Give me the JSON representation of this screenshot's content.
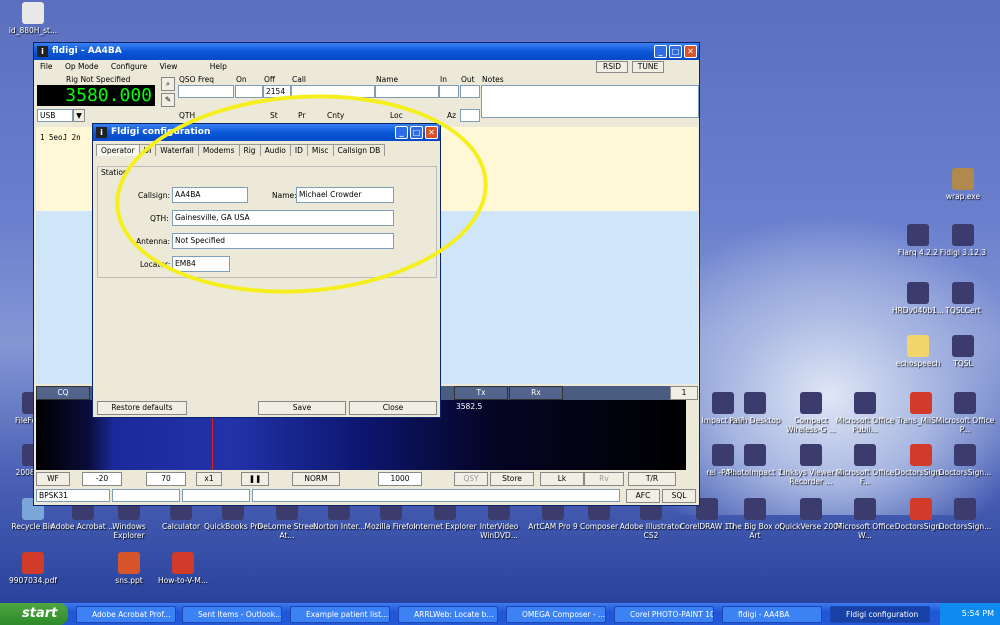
{
  "desktop_icons": [
    {
      "label": "id_880H_st...",
      "icon": "file-icon"
    },
    {
      "label": "wrap.exe",
      "icon": "box-icon"
    },
    {
      "label": "Flarq 4.2.2",
      "icon": "app-icon"
    },
    {
      "label": "Fldigi 3.12.3",
      "icon": "app-icon"
    },
    {
      "label": "HRDv040b1...",
      "icon": "app-icon"
    },
    {
      "label": "TQSLCert",
      "icon": "app-icon"
    },
    {
      "label": "echospeech",
      "icon": "folder-icon"
    },
    {
      "label": "TQSL",
      "icon": "app-icon"
    },
    {
      "label": "FileForma",
      "icon": "app-icon"
    },
    {
      "label": "2008Tour",
      "icon": "app-icon"
    },
    {
      "label": "Impact m 7",
      "icon": "app-icon"
    },
    {
      "label": "Palm Desktop",
      "icon": "app-icon"
    },
    {
      "label": "Compact Wireless-G ...",
      "icon": "app-icon"
    },
    {
      "label": "Microsoft Office Publi...",
      "icon": "app-icon"
    },
    {
      "label": "Trans_MilSi...",
      "icon": "pdf-icon"
    },
    {
      "label": "Microsoft Office P...",
      "icon": "app-icon"
    },
    {
      "label": "rel -PAI...",
      "icon": "app-icon"
    },
    {
      "label": "PhotoImpact 7",
      "icon": "app-icon"
    },
    {
      "label": "Linksys Viewer & Recorder ...",
      "icon": "app-icon"
    },
    {
      "label": "Microsoft Office F...",
      "icon": "app-icon"
    },
    {
      "label": "DoctorsSign...",
      "icon": "pdf-icon"
    },
    {
      "label": "DoctorsSign...",
      "icon": "app-icon"
    },
    {
      "label": "Recycle Bin",
      "icon": "recycle-icon"
    },
    {
      "label": "Adobe Acrobat ...",
      "icon": "app-icon"
    },
    {
      "label": "Windows Explorer",
      "icon": "app-icon"
    },
    {
      "label": "Calculator",
      "icon": "app-icon"
    },
    {
      "label": "QuickBooks Pro",
      "icon": "app-icon"
    },
    {
      "label": "DeLorme Street At...",
      "icon": "app-icon"
    },
    {
      "label": "Norton Inter...",
      "icon": "app-icon"
    },
    {
      "label": "Mozilla Firefox",
      "icon": "app-icon"
    },
    {
      "label": "Internet Explorer",
      "icon": "app-icon"
    },
    {
      "label": "InterVideo WinDVD...",
      "icon": "app-icon"
    },
    {
      "label": "ArtCAM Pro 9",
      "icon": "app-icon"
    },
    {
      "label": "Composer",
      "icon": "app-icon"
    },
    {
      "label": "Adobe Illustrator CS2",
      "icon": "app-icon"
    },
    {
      "label": "CorelDRAW 10",
      "icon": "app-icon"
    },
    {
      "label": "The Big Box of Art",
      "icon": "app-icon"
    },
    {
      "label": "QuickVerse 2007",
      "icon": "app-icon"
    },
    {
      "label": "Microsoft Office W...",
      "icon": "app-icon"
    },
    {
      "label": "DoctorsSign...",
      "icon": "pdf-icon"
    },
    {
      "label": "DoctorsSign...",
      "icon": "app-icon"
    },
    {
      "label": "9907034.pdf",
      "icon": "pdf-icon"
    },
    {
      "label": "sns.ppt",
      "icon": "ppt-icon"
    },
    {
      "label": "How-to-V-M...",
      "icon": "pdf-icon"
    }
  ],
  "main_window": {
    "title": "fldigi - AA4BA",
    "menu": [
      "File",
      "Op Mode",
      "Configure",
      "View",
      "Help"
    ],
    "rsid": "RSID",
    "tune": "TUNE",
    "rig_status": "Rig Not Specified",
    "frequency": "3580.000",
    "mode": "USB",
    "headers": {
      "qso_freq": "QSO Freq",
      "on": "On",
      "off": "Off",
      "call": "Call",
      "name": "Name",
      "in": "In",
      "out": "Out",
      "notes": "Notes"
    },
    "off_value": "2154",
    "row2": {
      "qth": "QTH",
      "st": "St",
      "pr": "Pr",
      "cnty": "Cnty",
      "loc": "Loc",
      "az": "Az"
    },
    "rx_text": "1  5eoJ  2n",
    "cq": "CQ",
    "tx": "Tx",
    "rx": "Rx",
    "count": "1",
    "waterfall_freq": "3582.5",
    "controls": {
      "wf": "WF",
      "level1": "-20",
      "level2": "70",
      "zoom": "x1",
      "norm": "NORM",
      "freq": "1000",
      "qsy": "QSY",
      "store": "Store",
      "lk": "Lk",
      "rv": "Rv",
      "tr": "T/R"
    },
    "status": {
      "mode": "BPSK31",
      "afc": "AFC",
      "sql": "SQL"
    }
  },
  "config_dialog": {
    "title": "Fldigi configuration",
    "tabs": [
      "Operator",
      "UI",
      "Waterfall",
      "Modems",
      "Rig",
      "Audio",
      "ID",
      "Misc",
      "Callsign DB"
    ],
    "group": "Station",
    "callsign_label": "Callsign:",
    "callsign": "AA4BA",
    "name_label": "Name:",
    "name": "Michael Crowder",
    "qth_label": "QTH:",
    "qth": "Gainesville, GA USA",
    "antenna_label": "Antenna:",
    "antenna": "Not Specified",
    "locator_label": "Locator:",
    "locator": "EM84",
    "restore": "Restore defaults",
    "save": "Save",
    "close": "Close"
  },
  "taskbar": {
    "start": "start",
    "tasks": [
      "Adobe Acrobat Prof...",
      "Sent Items - Outlook...",
      "Example patient list....",
      "ARRLWeb: Locate b...",
      "OMEGA Composer - ...",
      "Corel PHOTO-PAINT 10",
      "fldigi - AA4BA",
      "Fldigi configuration"
    ],
    "clock": "5:54 PM"
  },
  "colors": {
    "highlight": "#f6ef1e",
    "freq_bg": "#000000",
    "freq_fg": "#00ff00",
    "rx_bg": "#fff7d5",
    "tx_bg": "#cfe6fa"
  }
}
